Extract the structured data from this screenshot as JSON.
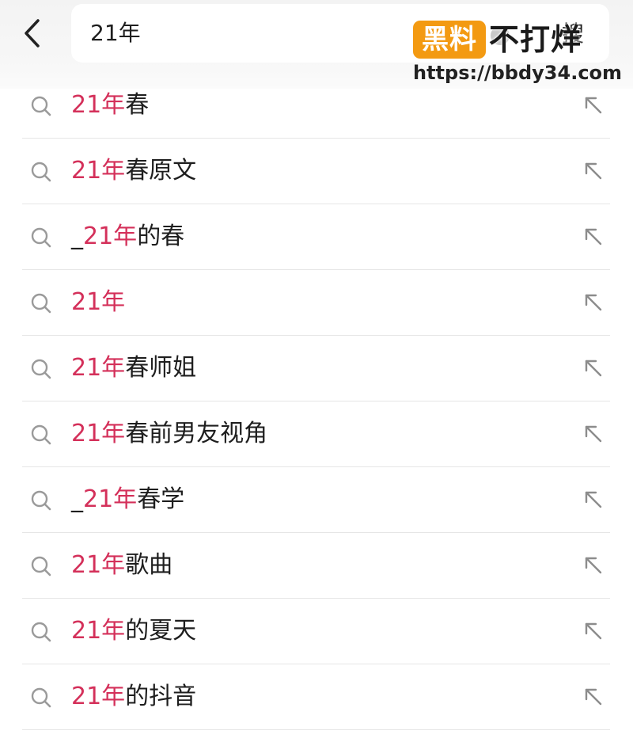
{
  "header": {
    "back_icon": "chevron-left-icon",
    "search": {
      "value": "21年",
      "clear_icon": "clear-icon",
      "submit_label": "搜"
    }
  },
  "watermark": {
    "badge": "黑料",
    "text": "不打烊",
    "url": "https://bbdy34.com",
    "badge_color": "#f39a12"
  },
  "colors": {
    "highlight": "#d4305a",
    "text": "#1e1e1e",
    "divider": "#e6e6e6"
  },
  "suggestions": [
    {
      "prefix": "",
      "match": "21年",
      "suffix": "春"
    },
    {
      "prefix": "",
      "match": "21年",
      "suffix": "春原文"
    },
    {
      "prefix": "_",
      "match": "21年",
      "suffix": "的春"
    },
    {
      "prefix": "",
      "match": "21年",
      "suffix": ""
    },
    {
      "prefix": "",
      "match": "21年",
      "suffix": "春师姐"
    },
    {
      "prefix": "",
      "match": "21年",
      "suffix": "春前男友视角"
    },
    {
      "prefix": "_",
      "match": "21年",
      "suffix": "春学"
    },
    {
      "prefix": "",
      "match": "21年",
      "suffix": "歌曲"
    },
    {
      "prefix": "",
      "match": "21年",
      "suffix": "的夏天"
    },
    {
      "prefix": "",
      "match": "21年",
      "suffix": "的抖音"
    }
  ]
}
